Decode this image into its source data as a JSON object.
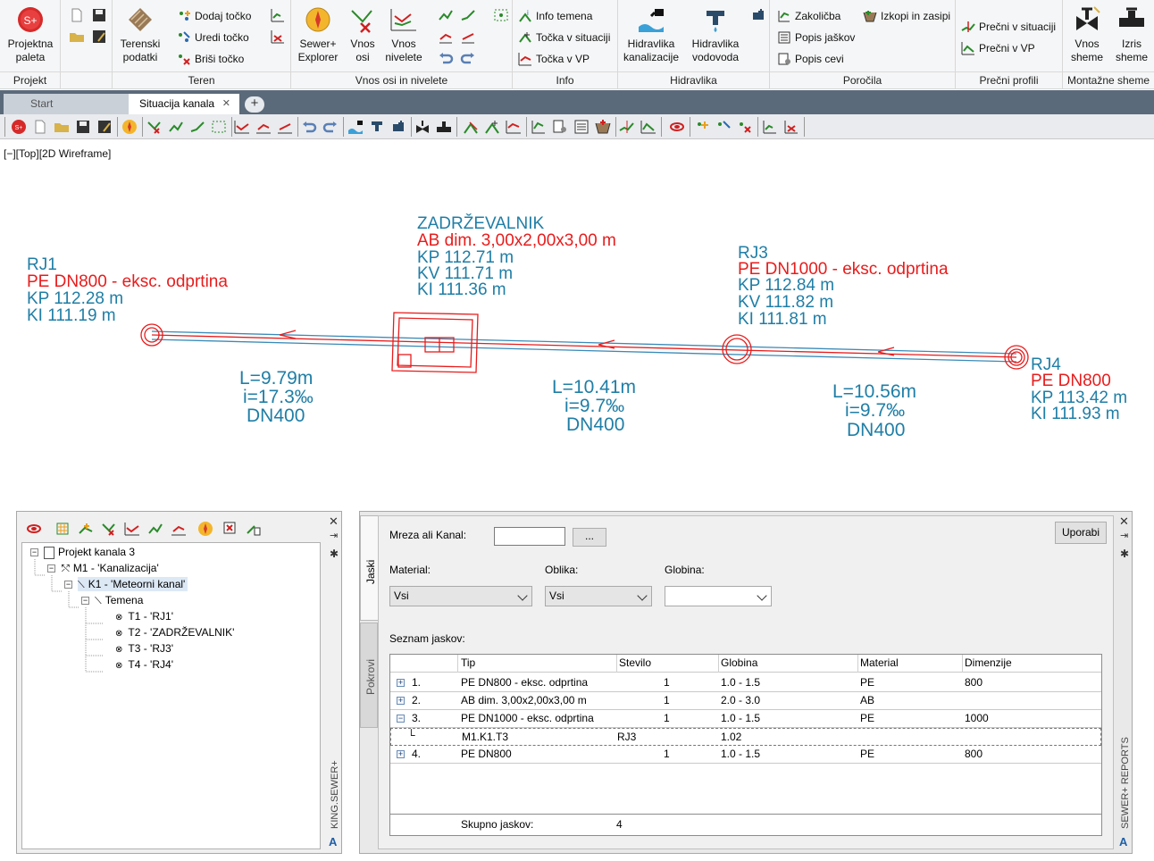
{
  "ribbon": {
    "groups": {
      "projekt": "Projekt",
      "teren": "Teren",
      "vnos_osi": "Vnos osi in nivelete",
      "info": "Info",
      "hidravlika": "Hidravlika",
      "porocila": "Poročila",
      "precni": "Prečni profili",
      "montazne": "Montažne sheme"
    },
    "projektna_paleta": [
      "Projektna",
      "paleta"
    ],
    "terenski": [
      "Terenski",
      "podatki"
    ],
    "dodaj_tocko": "Dodaj točko",
    "uredi_tocko": "Uredi točko",
    "brisi_tocko": "Briši točko",
    "sewer_explorer": [
      "Sewer+",
      "Explorer"
    ],
    "vnos_osi": [
      "Vnos",
      "osi"
    ],
    "vnos_nivelete": [
      "Vnos",
      "nivelete"
    ],
    "info_temena": "Info temena",
    "tocka_situacija": "Točka v situaciji",
    "tocka_vp": "Točka v VP",
    "hidr_kanal": [
      "Hidravlika",
      "kanalizacije"
    ],
    "hidr_vod": [
      "Hidravlika",
      "vodovoda"
    ],
    "zakolicba": "Zakoličba",
    "popis_jaskov": "Popis jaškov",
    "popis_cevi": "Popis cevi",
    "izkopi": "Izkopi in zasipi",
    "precni_situacija": "Prečni v situaciji",
    "precni_vp": "Prečni v VP",
    "vnos_sheme": [
      "Vnos",
      "sheme"
    ],
    "izris_sheme": [
      "Izris",
      "sheme"
    ]
  },
  "tabs": {
    "start": "Start",
    "active": "Situacija kanala",
    "close": "✕",
    "add": "+"
  },
  "viewport": {
    "label": "[−][Top][2D Wireframe]",
    "nodes": {
      "rj1": {
        "name": "RJ1",
        "type": "PE DN800 - eksc. odprtina",
        "kp": "KP 112.28 m",
        "ki": "KI 111.19 m"
      },
      "zadr": {
        "name": "ZADRŽEVALNIK",
        "type": "AB dim. 3,00x2,00x3,00 m",
        "kp": "KP 112.71 m",
        "kv": "KV 111.71 m",
        "ki": "KI 111.36 m"
      },
      "rj3": {
        "name": "RJ3",
        "type": "PE DN1000 - eksc. odprtina",
        "kp": "KP 112.84 m",
        "kv": "KV 111.82 m",
        "ki": "KI 111.81 m"
      },
      "rj4": {
        "name": "RJ4",
        "type": "PE DN800",
        "kp": "KP 113.42 m",
        "ki": "KI 111.93 m"
      }
    },
    "segments": [
      {
        "l": "L=9.79m",
        "i": "i=17.3‰",
        "dn": "DN400"
      },
      {
        "l": "L=10.41m",
        "i": "i=9.7‰",
        "dn": "DN400"
      },
      {
        "l": "L=10.56m",
        "i": "i=9.7‰",
        "dn": "DN400"
      }
    ]
  },
  "tree": {
    "projekt": "Projekt kanala 3",
    "m1": "M1 - 'Kanalizacija'",
    "k1": "K1 - 'Meteorni kanal'",
    "temena": "Temena",
    "t1": "T1 - 'RJ1'",
    "t2": "T2 - 'ZADRŽEVALNIK'",
    "t3": "T3 - 'RJ3'",
    "t4": "T4 - 'RJ4'",
    "side_title": "KING.SEWER+"
  },
  "reports": {
    "side_title": "SEWER+ REPORTS",
    "vtab_jaski": "Jaski",
    "vtab_pokrovi": "Pokrovi",
    "mreza_label": "Mreza ali Kanal:",
    "mreza_value": "",
    "browse": "...",
    "uporabi": "Uporabi",
    "material_label": "Material:",
    "material_value": "Vsi",
    "oblika_label": "Oblika:",
    "oblika_value": "Vsi",
    "globina_label": "Globina:",
    "globina_value": "",
    "seznam": "Seznam jaskov:",
    "columns": [
      "Tip",
      "Stevilo",
      "Globina",
      "Material",
      "Dimenzije"
    ],
    "rows": [
      {
        "no": "1.",
        "tip": "PE DN800 - eksc. odprtina",
        "stevilo": "1",
        "globina": "1.0 - 1.5",
        "material": "PE",
        "dim": "800",
        "exp": "+"
      },
      {
        "no": "2.",
        "tip": "AB dim. 3,00x2,00x3,00 m",
        "stevilo": "1",
        "globina": "2.0 - 3.0",
        "material": "AB",
        "dim": "",
        "exp": "+"
      },
      {
        "no": "3.",
        "tip": "PE DN1000 - eksc. odprtina",
        "stevilo": "1",
        "globina": "1.0 - 1.5",
        "material": "PE",
        "dim": "1000",
        "exp": "−"
      },
      {
        "no": "4.",
        "tip": "PE DN800",
        "stevilo": "1",
        "globina": "1.0 - 1.5",
        "material": "PE",
        "dim": "800",
        "exp": "+"
      }
    ],
    "subrow": {
      "tip": "M1.K1.T3",
      "stevilo": "RJ3",
      "globina": "1.02"
    },
    "total_label": "Skupno jaskov:",
    "total_value": "4"
  },
  "colors": {
    "accent_blue": "#1f7ea6",
    "accent_red": "#e81c1c"
  }
}
